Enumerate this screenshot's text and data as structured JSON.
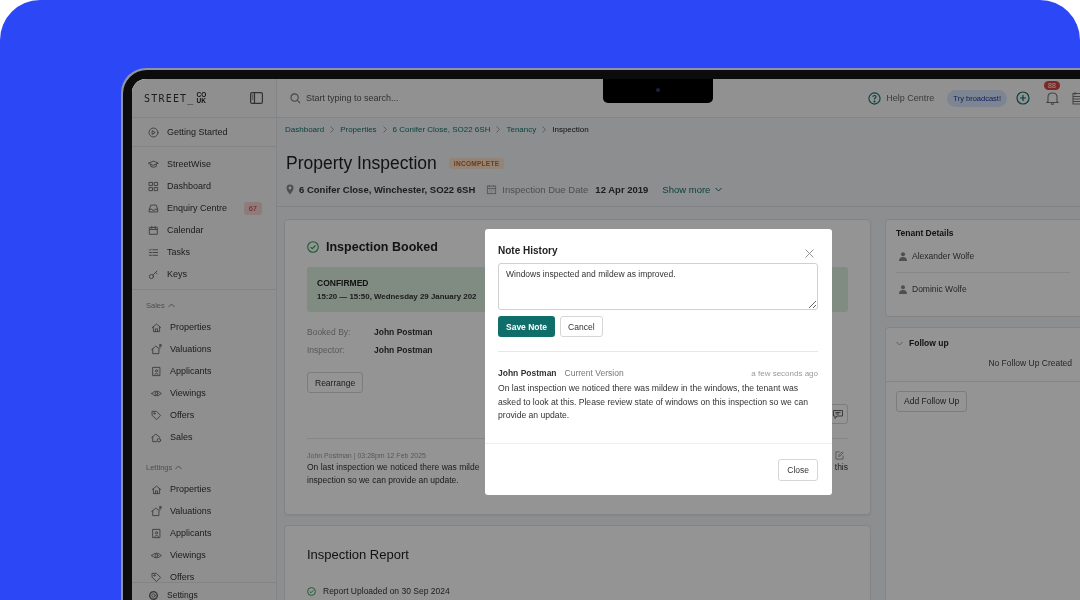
{
  "logo": {
    "text": "STREET_",
    "suffix_top": "CO",
    "suffix_bottom": "UK"
  },
  "sidebar": {
    "start_item": {
      "label": "Getting Started"
    },
    "main_items": [
      {
        "label": "StreetWise"
      },
      {
        "label": "Dashboard"
      },
      {
        "label": "Enquiry Centre",
        "badge": "67"
      },
      {
        "label": "Calendar"
      },
      {
        "label": "Tasks"
      },
      {
        "label": "Keys"
      }
    ],
    "sections": [
      {
        "title": "Sales",
        "expanded": true,
        "items": [
          {
            "label": "Properties"
          },
          {
            "label": "Valuations"
          },
          {
            "label": "Applicants"
          },
          {
            "label": "Viewings"
          },
          {
            "label": "Offers"
          },
          {
            "label": "Sales"
          }
        ]
      },
      {
        "title": "Lettings",
        "expanded": true,
        "items": [
          {
            "label": "Properties"
          },
          {
            "label": "Valuations"
          },
          {
            "label": "Applicants"
          },
          {
            "label": "Viewings"
          },
          {
            "label": "Offers"
          }
        ]
      }
    ],
    "footer_item": {
      "label": "Settings"
    }
  },
  "topbar": {
    "search": {
      "placeholder": "Start typing to search..."
    },
    "help": "Help Centre",
    "broadcast": "Try broadcast!",
    "notification_count": "88"
  },
  "breadcrumb": [
    {
      "label": "Dashboard",
      "current": false
    },
    {
      "label": "Properties",
      "current": false
    },
    {
      "label": "6 Conifer Close, SO22 6SH",
      "current": false
    },
    {
      "label": "Tenancy",
      "current": false
    },
    {
      "label": "Inspection",
      "current": true
    }
  ],
  "header": {
    "title": "Property Inspection",
    "status": "INCOMPLETE",
    "address": "6 Conifer Close, Winchester, SO22 6SH",
    "due_label": "Inspection Due Date",
    "due_date": "12 Apr 2019",
    "show_more": "Show more"
  },
  "booking": {
    "title": "Inspection Booked",
    "status": "CONFIRMED",
    "time": "15:20 — 15:50, Wednesday 29 January 202",
    "details": [
      {
        "label": "Booked By:",
        "value": "John Postman"
      },
      {
        "label": "Inspector:",
        "value": "John Postman"
      }
    ],
    "rearrange": "Rearrange",
    "note": {
      "meta": "John Postman | 03:28pm 12 Feb 2025",
      "line_1": "On last inspection we noticed there was milde",
      "line_1_end": "this",
      "line_2": "inspection so we can provide an update."
    }
  },
  "report": {
    "title": "Inspection Report",
    "item": "Report Uploaded on 30 Sep 2024"
  },
  "tenants": {
    "title": "Tenant Details",
    "people": [
      "Alexander Wolfe",
      "Dominic Wolfe"
    ]
  },
  "follow_up": {
    "title": "Follow up",
    "empty": "No Follow Up Created",
    "add": "Add Follow Up"
  },
  "modal": {
    "title": "Note History",
    "note_value": "Windows inspected and mildew as improved.",
    "save": "Save Note",
    "cancel": "Cancel",
    "history": [
      {
        "author": "John Postman",
        "version": "Current Version",
        "time": "a few seconds ago",
        "text": "On last inspection we noticed there was mildew in the windows, the tenant was asked to look at this. Please review state of windows on this inspection so we can provide an update."
      }
    ],
    "close": "Close"
  }
}
